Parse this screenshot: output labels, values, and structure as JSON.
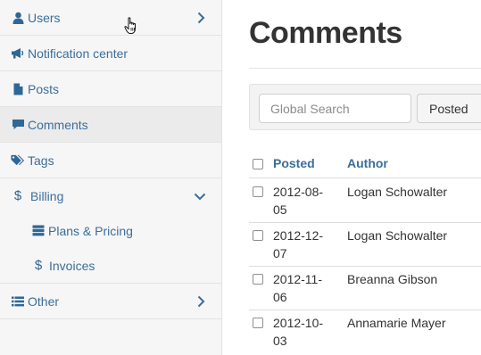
{
  "sidebar": {
    "items": [
      {
        "label": "Users",
        "icon": "user-icon",
        "has_chevron": "right"
      },
      {
        "label": "Notification center",
        "icon": "megaphone-icon"
      },
      {
        "label": "Posts",
        "icon": "document-icon"
      },
      {
        "label": "Comments",
        "icon": "comment-icon",
        "active": true
      },
      {
        "label": "Tags",
        "icon": "tags-icon"
      },
      {
        "label": "Billing",
        "icon": "dollar-icon",
        "has_chevron": "down"
      },
      {
        "label": "Other",
        "icon": "list-icon",
        "has_chevron": "right"
      }
    ],
    "billing_children": [
      {
        "label": "Plans & Pricing",
        "icon": "server-icon"
      },
      {
        "label": "Invoices",
        "icon": "dollar-icon"
      }
    ]
  },
  "main": {
    "title": "Comments",
    "search": {
      "placeholder": "Global Search"
    },
    "filter_button": "Posted",
    "table": {
      "headers": {
        "posted": "Posted",
        "author": "Author"
      },
      "rows": [
        {
          "posted": "2012-08-05",
          "author": "Logan Schowalter"
        },
        {
          "posted": "2012-12-07",
          "author": "Logan Schowalter"
        },
        {
          "posted": "2012-11-06",
          "author": "Breanna Gibson"
        },
        {
          "posted": "2012-10-03",
          "author": "Annamarie Mayer"
        }
      ]
    }
  },
  "colors": {
    "link": "#3a6e9c",
    "sidebar_bg": "#f6f6f6",
    "active_bg": "#ebebeb"
  }
}
